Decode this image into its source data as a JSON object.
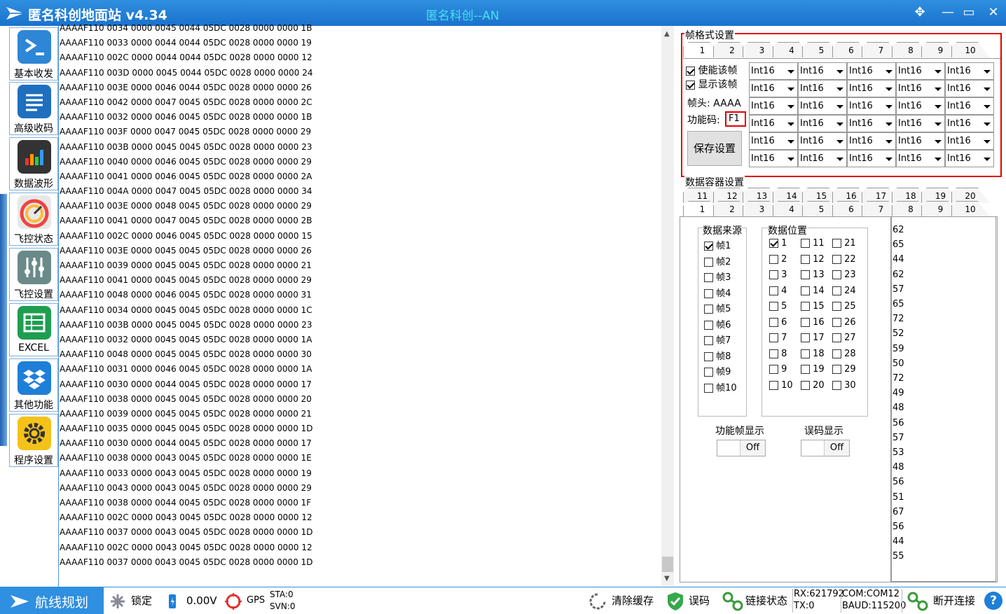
{
  "window": {
    "title": "匿名科创地面站 v4.34",
    "center_title": "匿名科创--AN"
  },
  "sidebar": {
    "items": [
      {
        "label": "基本收发",
        "icon": "terminal-icon"
      },
      {
        "label": "高级收码",
        "icon": "list-icon"
      },
      {
        "label": "数据波形",
        "icon": "bar-chart-icon"
      },
      {
        "label": "飞控状态",
        "icon": "gauge-icon"
      },
      {
        "label": "飞控设置",
        "icon": "sliders-icon"
      },
      {
        "label": "EXCEL",
        "icon": "spreadsheet-icon"
      },
      {
        "label": "其他功能",
        "icon": "dropbox-icon"
      },
      {
        "label": "程序设置",
        "icon": "gear-icon"
      }
    ]
  },
  "log": {
    "lines": [
      "AAAAF110 0034 0000 0045 0044 05DC 0028 0000 0000 1B",
      "AAAAF110 0033 0000 0044 0044 05DC 0028 0000 0000 19",
      "AAAAF110 002C 0000 0044 0044 05DC 0028 0000 0000 12",
      "AAAAF110 003D 0000 0045 0044 05DC 0028 0000 0000 24",
      "AAAAF110 003E 0000 0046 0044 05DC 0028 0000 0000 26",
      "AAAAF110 0042 0000 0047 0045 05DC 0028 0000 0000 2C",
      "AAAAF110 0032 0000 0046 0045 05DC 0028 0000 0000 1B",
      "AAAAF110 003F 0000 0047 0045 05DC 0028 0000 0000 29",
      "AAAAF110 003B 0000 0045 0045 05DC 0028 0000 0000 23",
      "AAAAF110 0040 0000 0046 0045 05DC 0028 0000 0000 29",
      "AAAAF110 0041 0000 0046 0045 05DC 0028 0000 0000 2A",
      "AAAAF110 004A 0000 0047 0045 05DC 0028 0000 0000 34",
      "AAAAF110 003E 0000 0048 0045 05DC 0028 0000 0000 29",
      "AAAAF110 0041 0000 0047 0045 05DC 0028 0000 0000 2B",
      "AAAAF110 002C 0000 0046 0045 05DC 0028 0000 0000 15",
      "AAAAF110 003E 0000 0045 0045 05DC 0028 0000 0000 26",
      "AAAAF110 0039 0000 0045 0045 05DC 0028 0000 0000 21",
      "AAAAF110 0041 0000 0045 0045 05DC 0028 0000 0000 29",
      "AAAAF110 0048 0000 0046 0045 05DC 0028 0000 0000 31",
      "AAAAF110 0034 0000 0045 0045 05DC 0028 0000 0000 1C",
      "AAAAF110 003B 0000 0045 0045 05DC 0028 0000 0000 23",
      "AAAAF110 0032 0000 0045 0045 05DC 0028 0000 0000 1A",
      "AAAAF110 0048 0000 0045 0045 05DC 0028 0000 0000 30",
      "AAAAF110 0031 0000 0046 0045 05DC 0028 0000 0000 1A",
      "AAAAF110 0030 0000 0044 0045 05DC 0028 0000 0000 17",
      "AAAAF110 0038 0000 0045 0045 05DC 0028 0000 0000 20",
      "AAAAF110 0039 0000 0045 0045 05DC 0028 0000 0000 21",
      "AAAAF110 0035 0000 0045 0045 05DC 0028 0000 0000 1D",
      "AAAAF110 0030 0000 0044 0045 05DC 0028 0000 0000 17",
      "AAAAF110 0038 0000 0043 0045 05DC 0028 0000 0000 1E",
      "AAAAF110 0033 0000 0043 0045 05DC 0028 0000 0000 19",
      "AAAAF110 0043 0000 0043 0045 05DC 0028 0000 0000 29",
      "AAAAF110 0038 0000 0044 0045 05DC 0028 0000 0000 1F",
      "AAAAF110 002C 0000 0043 0045 05DC 0028 0000 0000 12",
      "AAAAF110 0037 0000 0043 0045 05DC 0028 0000 0000 1D",
      "AAAAF110 002C 0000 0043 0045 05DC 0028 0000 0000 12",
      "AAAAF110 0037 0000 0043 0045 05DC 0028 0000 0000 1D"
    ]
  },
  "frame_format": {
    "title": "帧格式设置",
    "tabs": [
      "1",
      "2",
      "3",
      "4",
      "5",
      "6",
      "7",
      "8",
      "9",
      "10"
    ],
    "active_tab": "1",
    "enable_frame": "使能该帧",
    "show_frame": "显示该帧",
    "header_label": "帧头: AAAA",
    "func_code_label": "功能码:",
    "func_code_value": "F1",
    "save_button": "保存设置",
    "type_value": "Int16"
  },
  "container": {
    "title": "数据容器设置",
    "tabs_row1": [
      "11",
      "12",
      "13",
      "14",
      "15",
      "16",
      "17",
      "18",
      "19",
      "20"
    ],
    "tabs_row2": [
      "1",
      "2",
      "3",
      "4",
      "5",
      "6",
      "7",
      "8",
      "9",
      "10"
    ],
    "active_tab": "1",
    "source_title": "数据来源",
    "sources": [
      "帧1",
      "帧2",
      "帧3",
      "帧4",
      "帧5",
      "帧6",
      "帧7",
      "帧8",
      "帧9",
      "帧10"
    ],
    "position_title": "数据位置",
    "positions": [
      "1",
      "2",
      "3",
      "4",
      "5",
      "6",
      "7",
      "8",
      "9",
      "10",
      "11",
      "12",
      "13",
      "14",
      "15",
      "16",
      "17",
      "18",
      "19",
      "20",
      "21",
      "22",
      "23",
      "24",
      "25",
      "26",
      "27",
      "28",
      "29",
      "30"
    ],
    "func_display_label": "功能帧显示",
    "func_display_value": "Off",
    "err_display_label": "误码显示",
    "err_display_value": "Off",
    "values": [
      "62",
      "65",
      "44",
      "62",
      "57",
      "65",
      "72",
      "52",
      "59",
      "50",
      "72",
      "49",
      "48",
      "56",
      "57",
      "53",
      "48",
      "56",
      "51",
      "67",
      "56",
      "44",
      "55"
    ]
  },
  "statusbar": {
    "route_planning": "航线规划",
    "lock": "锁定",
    "voltage": "0.00V",
    "gps": "GPS",
    "sta": "STA:0",
    "svn": "SVN:0",
    "clear_cache": "清除缓存",
    "error_code": "误码",
    "link_status": "链接状态",
    "rx": "RX:621792",
    "tx": "TX:0",
    "com": "COM:COM12",
    "baud": "BAUD:115200",
    "disconnect": "断开连接",
    "help_icon": "help-icon"
  },
  "colors": {
    "title_bar": "#1a72cc",
    "highlight_border": "#e00000",
    "accent": "#2f8fe0"
  }
}
